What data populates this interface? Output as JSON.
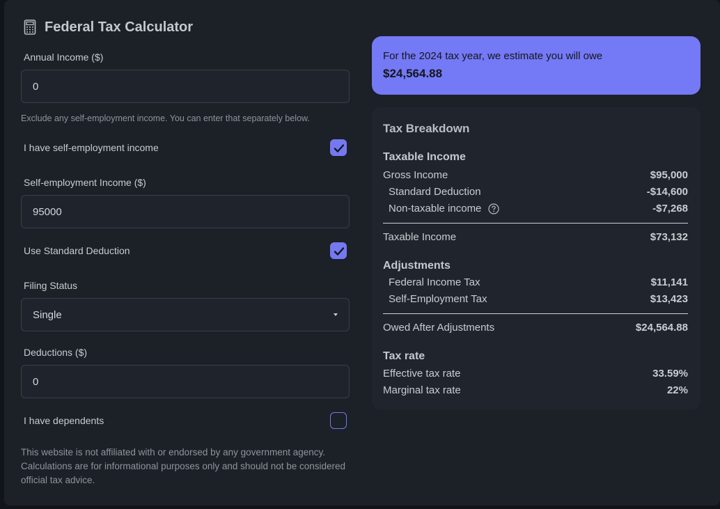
{
  "app": {
    "title": "Federal Tax Calculator",
    "accent_color": "#7479f5",
    "icons": {
      "title": "calculator-icon",
      "checked": "checkmark-icon",
      "select": "chevron-down-icon",
      "help": "question-circle-icon"
    }
  },
  "form": {
    "annual_income": {
      "label": "Annual Income ($)",
      "value": "0",
      "hint": "Exclude any self-employment income. You can enter that separately below."
    },
    "self_employment_toggle": {
      "label": "I have self-employment income",
      "checked": true
    },
    "self_employment_income": {
      "label": "Self-employment Income ($)",
      "value": "95000"
    },
    "standard_deduction_toggle": {
      "label": "Use Standard Deduction",
      "checked": true
    },
    "filing_status": {
      "label": "Filing Status",
      "value": "Single"
    },
    "deductions": {
      "label": "Deductions ($)",
      "value": "0"
    },
    "dependents_toggle": {
      "label": "I have dependents",
      "checked": false
    },
    "disclaimer": "This website is not affiliated with or endorsed by any government agency. Calculations are for informational purposes only and should not be considered official tax advice."
  },
  "summary": {
    "text": "For the 2024 tax year, we estimate you will owe",
    "amount": "$24,564.88"
  },
  "breakdown": {
    "title": "Tax Breakdown",
    "taxable_income": {
      "heading": "Taxable Income",
      "gross_label": "Gross Income",
      "gross_value": "$95,000",
      "std_deduction_label": "Standard Deduction",
      "std_deduction_value": "-$14,600",
      "nontaxable_label": "Non-taxable income",
      "nontaxable_value": "-$7,268",
      "total_label": "Taxable Income",
      "total_value": "$73,132"
    },
    "adjustments": {
      "heading": "Adjustments",
      "federal_label": "Federal Income Tax",
      "federal_value": "$11,141",
      "se_label": "Self-Employment Tax",
      "se_value": "$13,423",
      "total_label": "Owed After Adjustments",
      "total_value": "$24,564.88"
    },
    "tax_rate": {
      "heading": "Tax rate",
      "effective_label": "Effective tax rate",
      "effective_value": "33.59%",
      "marginal_label": "Marginal tax rate",
      "marginal_value": "22%"
    }
  }
}
